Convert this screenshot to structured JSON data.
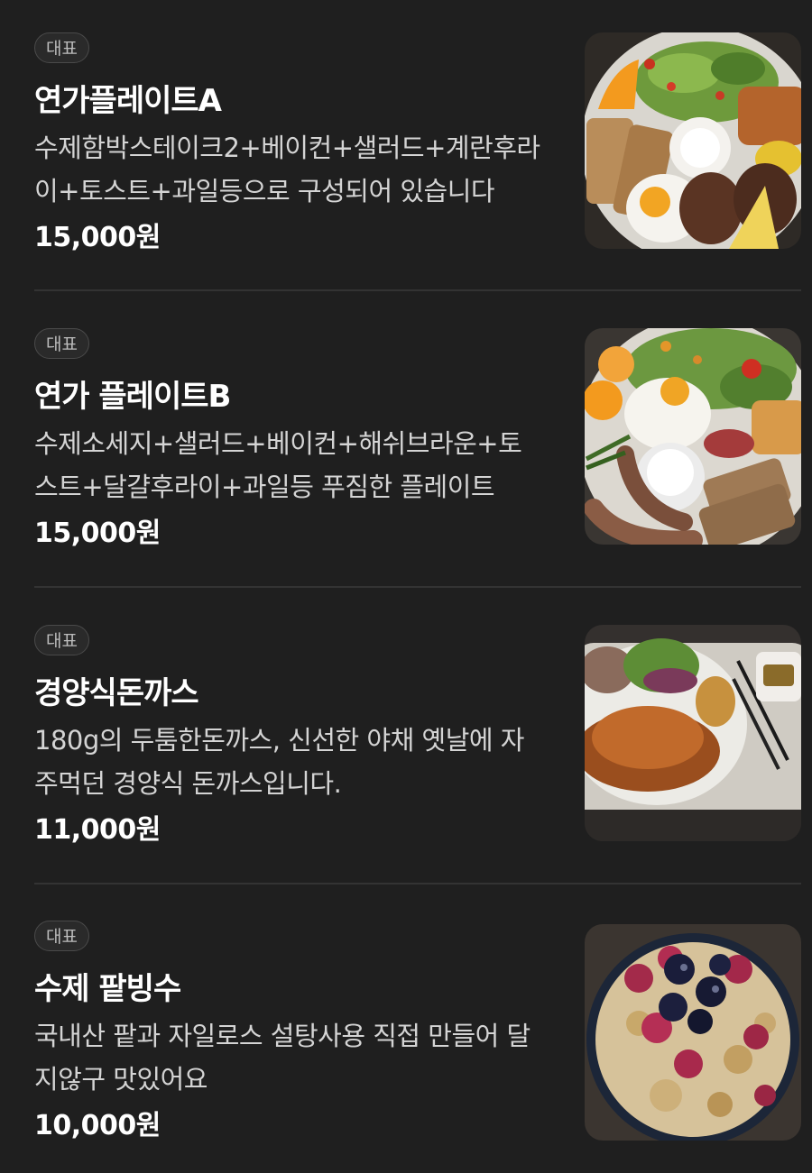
{
  "menu_items": [
    {
      "badge": "대표",
      "name": "연가플레이트A",
      "description": "수제함박스테이크2+베이컨+샐러드+계란후라이+토스트+과일등으로 구성되어 있습니다",
      "price": "15,000원",
      "image": "plate-a-photo"
    },
    {
      "badge": "대표",
      "name": "연가 플레이트B",
      "description": "수제소세지+샐러드+베이컨+해쉬브라운+토스트+달걀후라이+과일등 푸짐한 플레이트",
      "price": "15,000원",
      "image": "plate-b-photo"
    },
    {
      "badge": "대표",
      "name": "경양식돈까스",
      "description": "180g의 두툼한돈까스, 신선한 야채 옛날에 자주먹던 경양식 돈까스입니다.",
      "price": "11,000원",
      "image": "pork-cutlet-photo"
    },
    {
      "badge": "대표",
      "name": "수제 팥빙수",
      "description": "국내산 팥과 자일로스 설탕사용 직접 만들어 달지않구 맛있어요",
      "price": "10,000원",
      "image": "bingsu-photo"
    }
  ]
}
